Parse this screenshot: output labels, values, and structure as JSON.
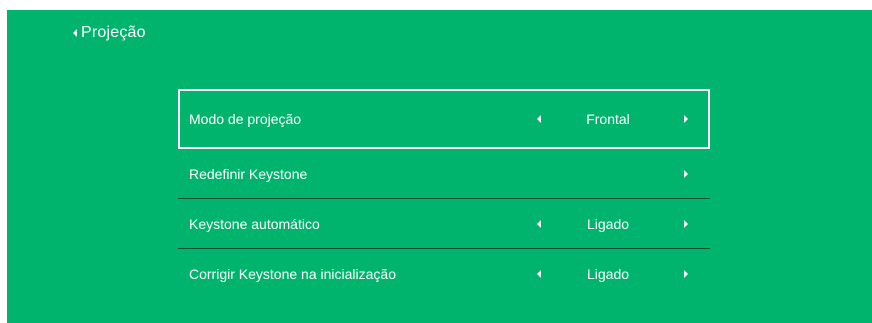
{
  "header": {
    "back_label": "Projeção"
  },
  "menu": {
    "items": [
      {
        "label": "Modo de projeção",
        "value": "Frontal"
      },
      {
        "label": "Redefinir Keystone",
        "value": ""
      },
      {
        "label": "Keystone automático",
        "value": "Ligado"
      },
      {
        "label": "Corrigir Keystone na inicialização",
        "value": "Ligado"
      }
    ]
  },
  "colors": {
    "background": "#00b46e",
    "text": "#ffffff",
    "page": "#ffffff"
  },
  "icons": {
    "back": "caret-left-icon",
    "prev": "caret-left-icon",
    "next": "caret-right-icon"
  }
}
